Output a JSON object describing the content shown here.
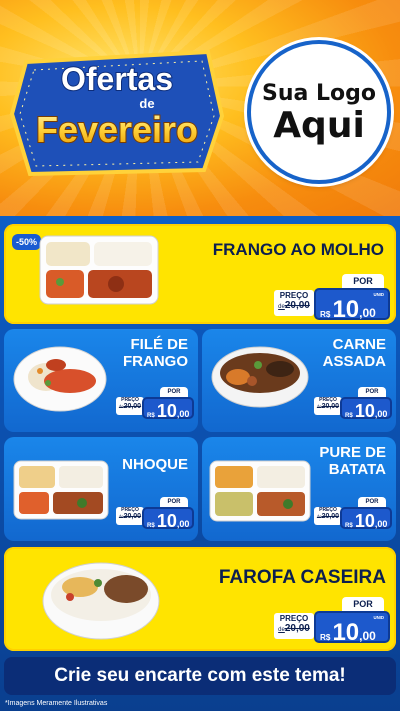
{
  "header": {
    "sign_line1": "Ofertas",
    "sign_line2": "de",
    "sign_line3": "Fevereiro",
    "logo_line1": "Sua Logo",
    "logo_line2": "Aqui"
  },
  "colors": {
    "primary_blue": "#1268cf",
    "yellow": "#ffe400",
    "orange": "#f78d0e",
    "navy": "#0c1f4f"
  },
  "products": [
    {
      "title_l1": "FRANGO AO MOLHO",
      "title_l2": "",
      "badge": "-50%",
      "por": "POR",
      "preco_label": "PREÇO",
      "de": "de",
      "old": "20,00",
      "rs": "R$",
      "price_int": "10",
      "price_cents": ",00",
      "unid": "UNID",
      "icon": "tray-chicken-sauce-icon"
    },
    {
      "title_l1": "FILÉ DE",
      "title_l2": "FRANGO",
      "por": "POR",
      "preco_label": "PREÇO",
      "de": "de",
      "old": "20,00",
      "rs": "R$",
      "price_int": "10",
      "price_cents": ",00",
      "unid": "UNID",
      "icon": "plate-chicken-fillet-icon"
    },
    {
      "title_l1": "CARNE",
      "title_l2": "ASSADA",
      "por": "POR",
      "preco_label": "PREÇO",
      "de": "de",
      "old": "20,00",
      "rs": "R$",
      "price_int": "10",
      "price_cents": ",00",
      "unid": "UNID",
      "icon": "bowl-roast-beef-icon"
    },
    {
      "title_l1": "NHOQUE",
      "title_l2": "",
      "por": "POR",
      "preco_label": "PREÇO",
      "de": "de",
      "old": "20,00",
      "rs": "R$",
      "price_int": "10",
      "price_cents": ",00",
      "unid": "UNID",
      "icon": "tray-gnocchi-icon"
    },
    {
      "title_l1": "PURE DE",
      "title_l2": "BATATA",
      "por": "POR",
      "preco_label": "PREÇO",
      "de": "de",
      "old": "20,00",
      "rs": "R$",
      "price_int": "10",
      "price_cents": ",00",
      "unid": "UNID",
      "icon": "tray-mashed-potato-icon"
    },
    {
      "title_l1": "FAROFA CASEIRA",
      "title_l2": "",
      "por": "POR",
      "preco_label": "PREÇO",
      "de": "de",
      "old": "20,00",
      "rs": "R$",
      "price_int": "10",
      "price_cents": ",00",
      "unid": "UNID",
      "icon": "bowl-farofa-icon"
    }
  ],
  "cta": "Crie seu encarte com este tema!",
  "disclaimer": "*Imagens Meramente Ilustrativas"
}
